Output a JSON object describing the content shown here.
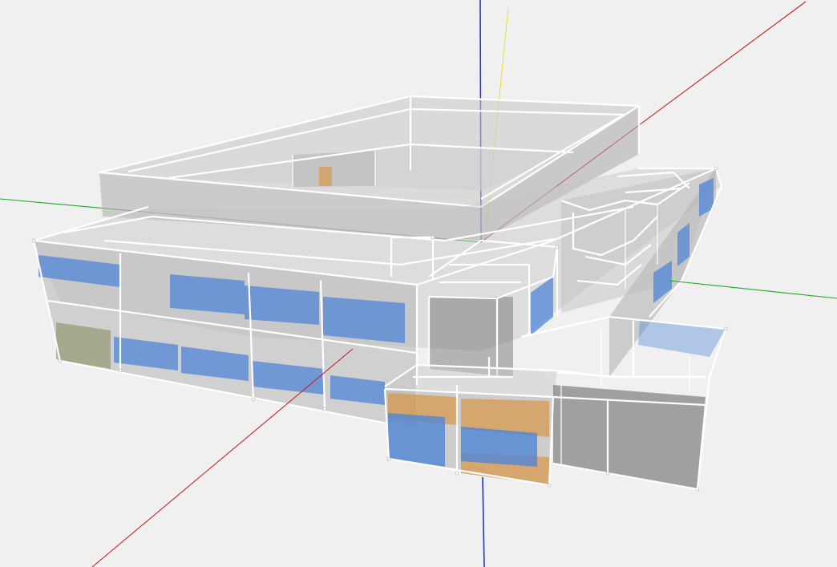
{
  "viewer": {
    "background_color": "#f0f0f0",
    "axis_colors": {
      "x": "#cc2222",
      "y": "#22aa22",
      "z": "#2233cc",
      "aux": "#e8e040"
    },
    "surface_colors": {
      "wall": "#bcbcbc",
      "window": "#4f86d6",
      "door": "#d79a4e",
      "dark_interior": "#6a6a6a",
      "olive_panel": "#8a8f60",
      "edge": "#ffffff"
    },
    "objects": [
      "building-model",
      "axis-x",
      "axis-y",
      "axis-z",
      "axis-aux"
    ]
  }
}
